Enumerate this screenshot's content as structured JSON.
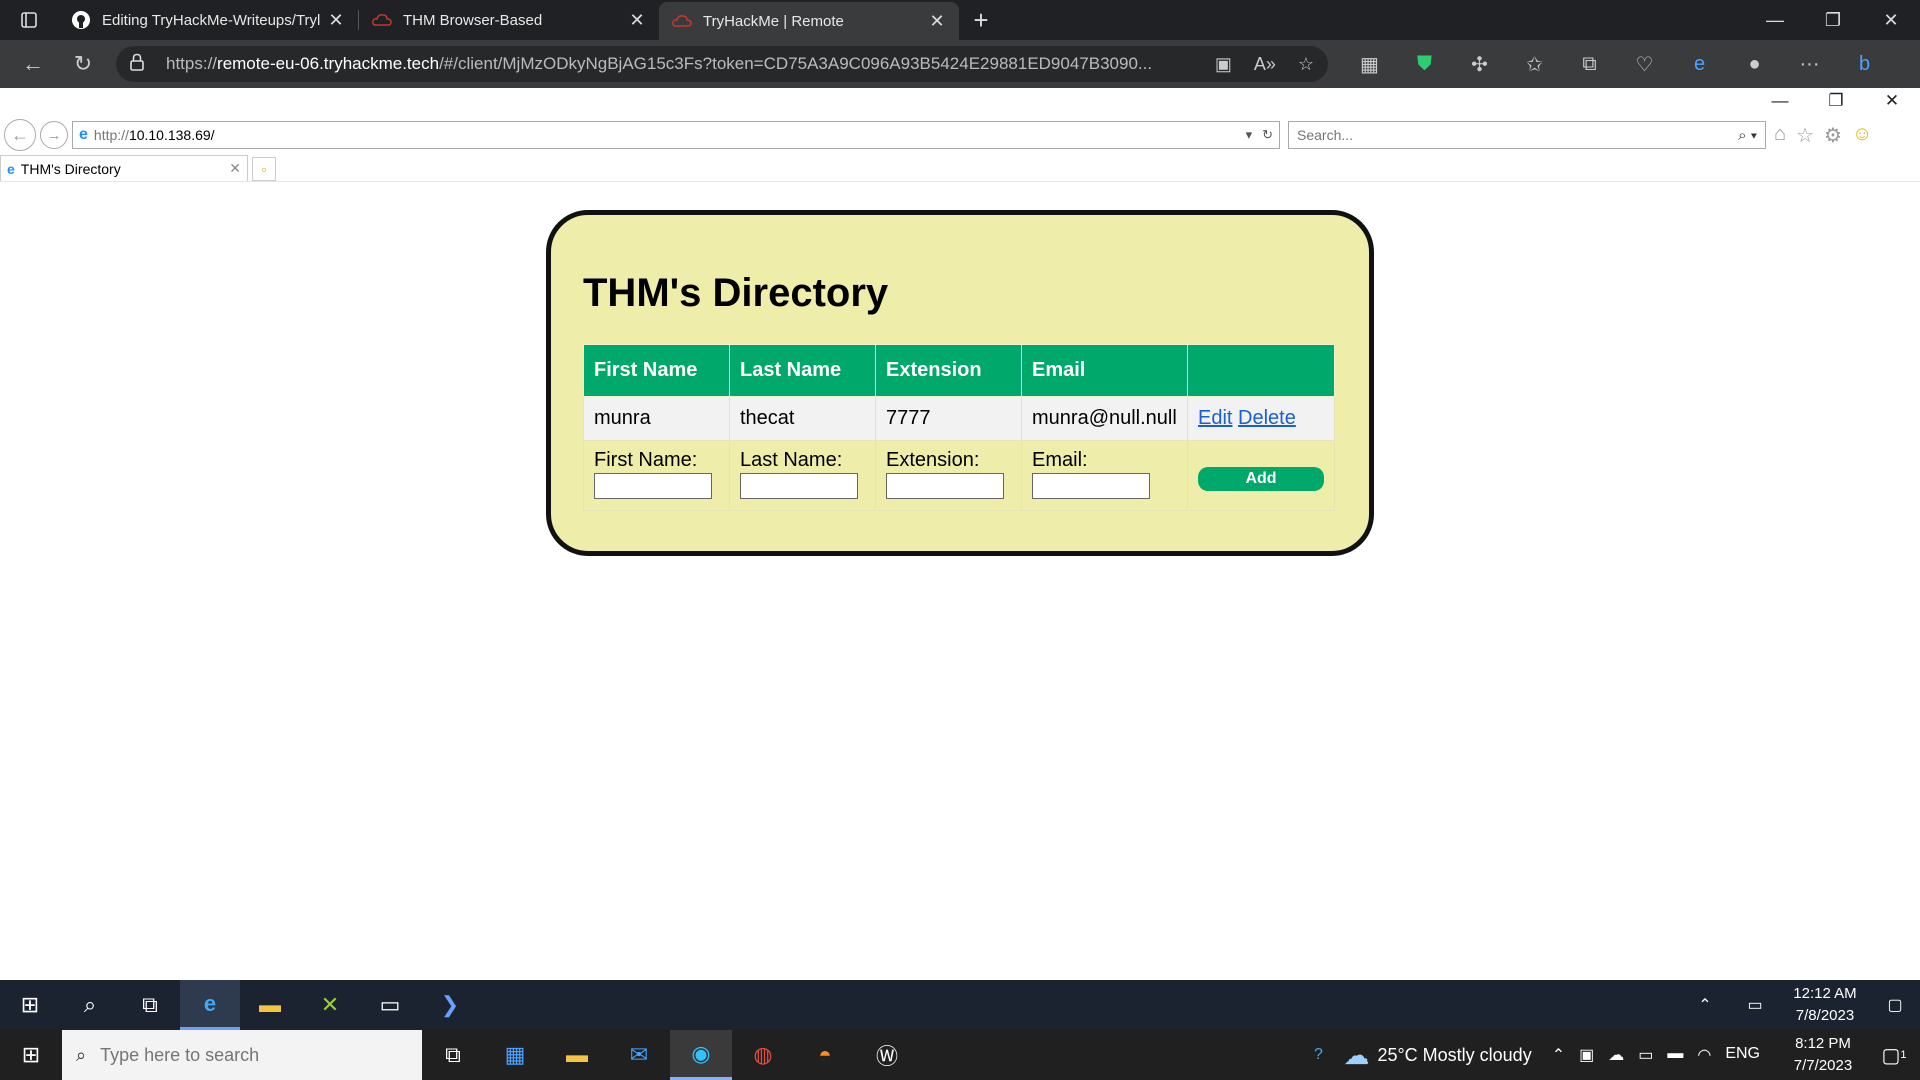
{
  "edge": {
    "tabs": [
      {
        "title": "Editing TryHackMe-Writeups/Tryl",
        "icon": "github-icon"
      },
      {
        "title": "THM Browser-Based",
        "icon": "tryhackme-icon"
      },
      {
        "title": "TryHackMe | Remote",
        "icon": "tryhackme-icon"
      }
    ],
    "address_url_prefix": "https://",
    "address_host": "remote-eu-06.tryhackme.tech",
    "address_rest": "/#/client/MjMzODkyNgBjAG15c3Fs?token=CD75A3A9C096A93B5424E29881ED9047B3090..."
  },
  "ie": {
    "url_prefix": "http://",
    "url_host": "10.10.138.69/",
    "search_placeholder": "Search...",
    "tab_title": "THM's Directory"
  },
  "directory": {
    "title": "THM's Directory",
    "headers": [
      "First Name",
      "Last Name",
      "Extension",
      "Email",
      ""
    ],
    "rows": [
      {
        "first_name": "munra",
        "last_name": "thecat",
        "extension": "7777",
        "email": "munra@null.null",
        "edit_label": "Edit",
        "delete_label": "Delete"
      }
    ],
    "form": {
      "first_name_label": "First Name:",
      "last_name_label": "Last Name:",
      "extension_label": "Extension:",
      "email_label": "Email:",
      "add_label": "Add"
    },
    "colors": {
      "header_bg": "#00a86b",
      "card_bg": "#eeeeaa"
    }
  },
  "remote_taskbar": {
    "time": "12:12 AM",
    "date": "7/8/2023"
  },
  "host_taskbar": {
    "search_placeholder": "Type here to search",
    "weather": "25°C  Mostly cloudy",
    "language": "ENG",
    "time": "8:12 PM",
    "date": "7/7/2023",
    "notification_count": "1"
  }
}
